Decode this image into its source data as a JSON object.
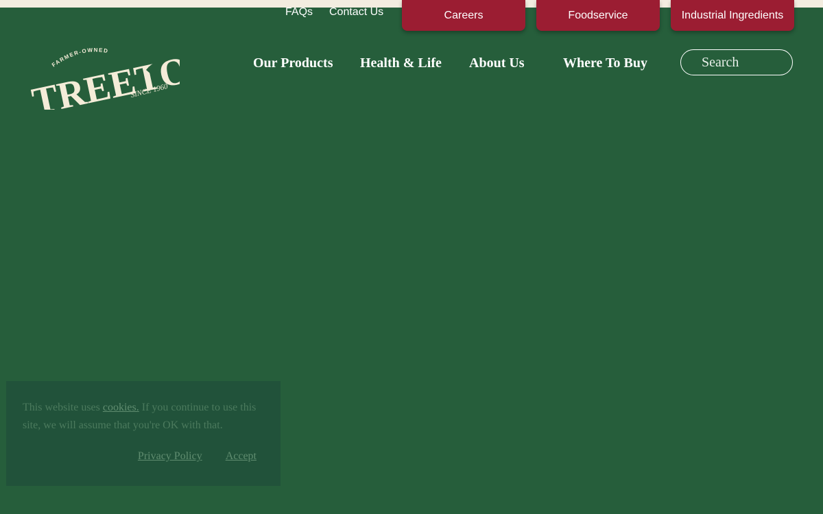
{
  "utility_nav": {
    "faqs": "FAQs",
    "contact": "Contact Us"
  },
  "tabs": {
    "careers": "Careers",
    "foodservice": "Foodservice",
    "industrial": "Industrial Ingredients"
  },
  "logo": {
    "name": "TREETOP",
    "tagline_top": "FARMER-OWNED",
    "tagline_bottom": "SINCE 1960"
  },
  "main_nav": [
    "Our Products",
    "Health & Life",
    "About Us",
    "Where To Buy"
  ],
  "search": {
    "placeholder": "Search"
  },
  "cookie_banner": {
    "text_before": "This website uses ",
    "cookies_link": "cookies.",
    "text_after": " If you continue to use this site, we will assume that you're OK with that.",
    "privacy_link": "Privacy Policy",
    "accept": "Accept"
  },
  "colors": {
    "background": "#265e3b",
    "top_strip": "#f3ede0",
    "tab_red": "#9b1d32",
    "logo_cream": "#f4ecd8"
  }
}
